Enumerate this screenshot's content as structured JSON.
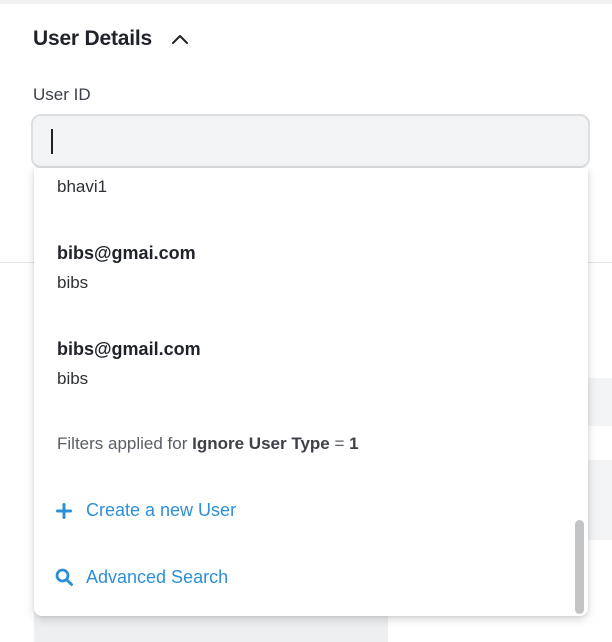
{
  "section": {
    "title": "User Details"
  },
  "field": {
    "label": "User ID",
    "value": "",
    "placeholder": ""
  },
  "dropdown": {
    "options": [
      {
        "primary": "",
        "secondary": "bhavi1"
      },
      {
        "primary": "bibs@gmai.com",
        "secondary": "bibs"
      },
      {
        "primary": "bibs@gmail.com",
        "secondary": "bibs"
      }
    ],
    "filters": {
      "prefix": "Filters applied for",
      "name": "Ignore User Type",
      "operator": "=",
      "value": "1"
    },
    "actions": {
      "create_label": "Create a new User",
      "advanced_label": "Advanced Search"
    }
  },
  "colors": {
    "accent": "#2c8fd8",
    "input_bg": "#f3f4f5"
  },
  "icons": {
    "collapse": "chevron-up-icon",
    "create": "plus-icon",
    "advanced": "search-icon"
  }
}
